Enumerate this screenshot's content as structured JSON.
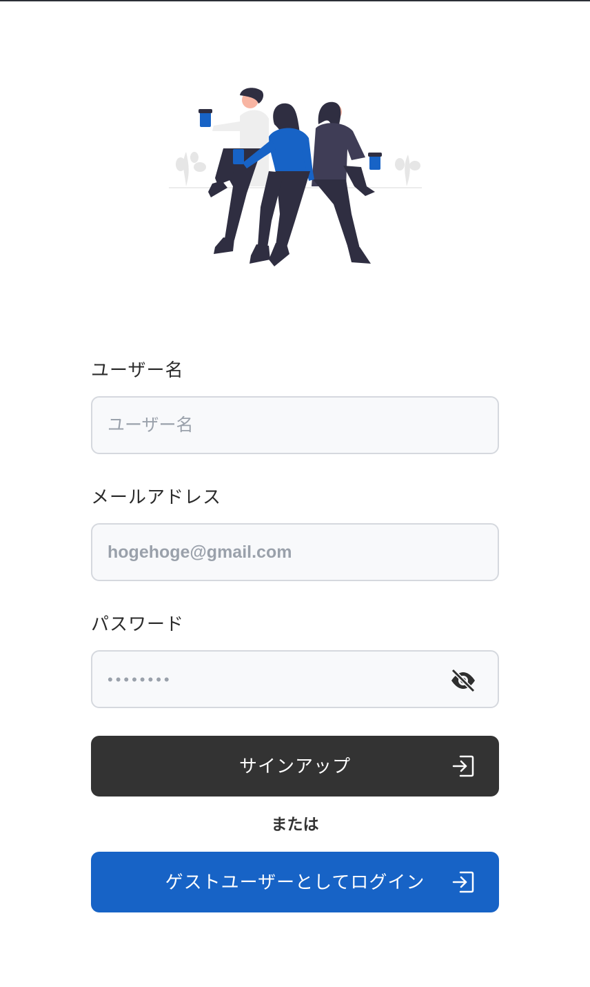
{
  "form": {
    "username": {
      "label": "ユーザー名",
      "placeholder": "ユーザー名"
    },
    "email": {
      "label": "メールアドレス",
      "placeholder": "hogehoge@gmail.com"
    },
    "password": {
      "label": "パスワード",
      "placeholder": "••••••••"
    }
  },
  "actions": {
    "signup_label": "サインアップ",
    "or_text": "または",
    "guest_login_label": "ゲストユーザーとしてログイン"
  },
  "colors": {
    "primary_dark": "#333333",
    "primary_blue": "#1763c6",
    "input_bg": "#f8f9fb",
    "input_border": "#d5d8de"
  },
  "icons": {
    "password_toggle": "eye-off-icon",
    "signup": "login-arrow-icon",
    "guest_login": "login-arrow-icon"
  }
}
